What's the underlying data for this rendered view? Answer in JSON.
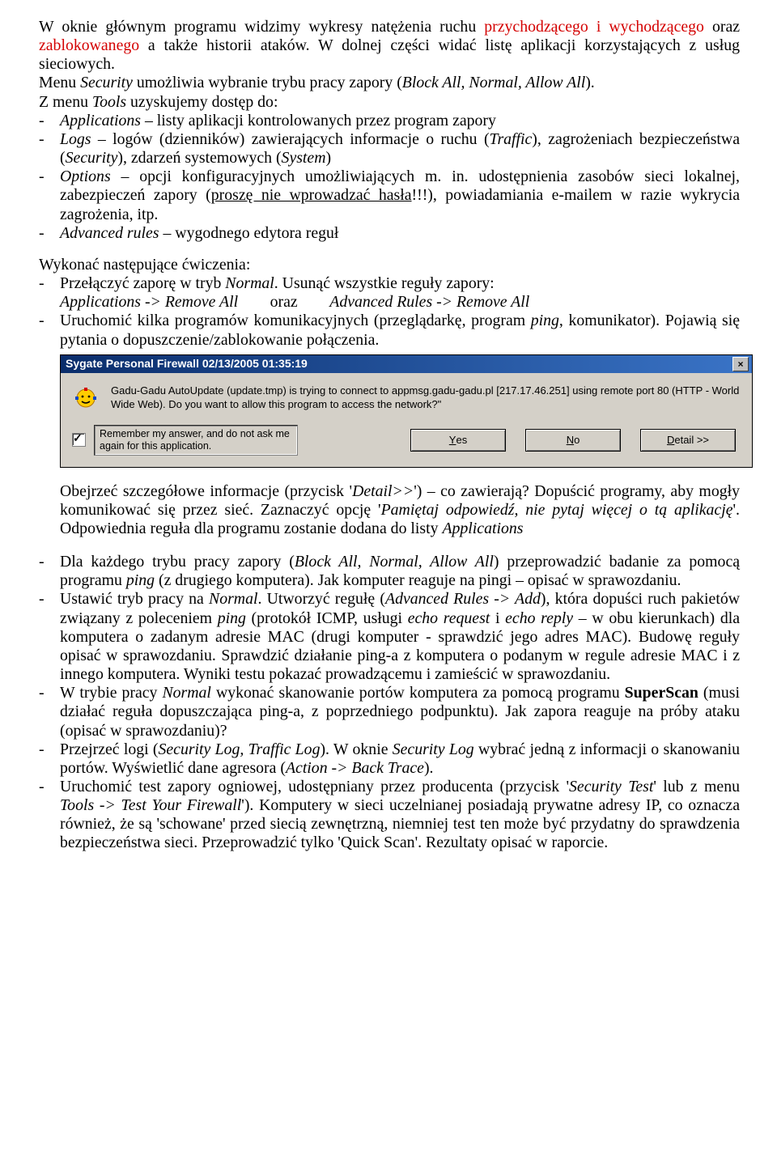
{
  "intro": {
    "pre_red1": "W oknie głównym programu widzimy wykresy natężenia ruchu ",
    "red1": "przychodzącego i wychodzącego",
    "between_red": " oraz ",
    "red2": "zablokowanego",
    "after_red": " a także historii ataków. W dolnej części widać listę aplikacji korzystających z usług sieciowych.",
    "menu_line_a": "Menu ",
    "menu_security": "Security",
    "menu_line_b": " umożliwia wybranie trybu pracy zapory (",
    "menu_modes": "Block All, Normal, Allow All",
    "menu_line_c": ").",
    "tools_a": "Z menu ",
    "tools_word": "Tools",
    "tools_b": " uzyskujemy dostęp do:"
  },
  "tools_items": {
    "dash": "-",
    "app_a": "Applications",
    "app_b": " – listy aplikacji kontrolowanych przez program zapory",
    "logs_a": "Logs",
    "logs_b": " – logów (dzienników) zawierających informacje o ruchu (",
    "logs_traffic": "Traffic",
    "logs_c": "), zagrożeniach bezpieczeństwa (",
    "logs_sec": "Security",
    "logs_d": "), zdarzeń systemowych (",
    "logs_sys": "System",
    "logs_e": ")",
    "opt_a": "Options",
    "opt_b": " – opcji konfiguracyjnych umożliwiających m. in. udostępnienia zasobów sieci lokalnej, zabezpieczeń zapory (",
    "opt_u": "proszę nie wprowadzać hasła",
    "opt_c": "!!!), powiadamiania e-mailem w razie wykrycia zagrożenia, itp.",
    "adv_a": "Advanced rules",
    "adv_b": " – wygodnego edytora reguł"
  },
  "exercise_heading": "Wykonać następujące ćwiczenia:",
  "ex1": {
    "a": "Przełączyć zaporę w tryb ",
    "normal": "Normal",
    "b": ". Usunąć wszystkie reguły zapory:",
    "line2_a": "Applications -> Remove All",
    "line2_mid": "        oraz        ",
    "line2_b": "Advanced Rules -> Remove All"
  },
  "ex2": {
    "a": "Uruchomić kilka programów komunikacyjnych (przeglądarkę, program ",
    "ping": "ping",
    "b": ", komunikator). Pojawią się pytania o dopuszczenie/zablokowanie połączenia."
  },
  "dialog": {
    "title": "Sygate Personal Firewall 02/13/2005 01:35:19",
    "msg": "Gadu-Gadu AutoUpdate (update.tmp) is trying to connect to appmsg.gadu-gadu.pl [217.17.46.251] using remote port 80 (HTTP - World Wide Web). Do you want to allow this program to access the network?\"",
    "remember": "Remember my answer, and do not ask me again for this application.",
    "yes_pre": "",
    "yes_u": "Y",
    "yes_post": "es",
    "no_pre": "",
    "no_u": "N",
    "no_post": "o",
    "detail_pre": "",
    "detail_u": "D",
    "detail_post": "etail >>"
  },
  "after_dialog": {
    "a": "Obejrzeć szczegółowe informacje (przycisk '",
    "detail": "Detail>>",
    "b": "') – co zawierają? Dopuścić programy, aby mogły komunikować się przez sieć. Zaznaczyć opcję '",
    "pam": "Pamiętaj odpowiedź, nie pytaj więcej o tą aplikację",
    "c": "'. Odpowiednia reguła dla programu zostanie dodana do listy ",
    "apps": "Applications"
  },
  "ex3": {
    "a": "Dla każdego trybu pracy zapory (",
    "modes": "Block All, Normal, Allow All",
    "b": ") przeprowadzić badanie za pomocą programu ",
    "ping": "ping",
    "c": " (z drugiego komputera). Jak komputer reaguje na pingi – opisać w sprawozdaniu."
  },
  "ex4": {
    "a": "Ustawić tryb pracy na ",
    "normal": "Normal",
    "b": ". Utworzyć regułę (",
    "adv": "Advanced Rules -> Add",
    "c": "), która dopuści ruch pakietów związany z poleceniem ",
    "ping": "ping",
    "d": " (protokół ICMP, usługi ",
    "ereq": "echo request",
    "e_and": " i ",
    "erep": "echo reply",
    "f": " – w obu kierunkach) dla komputera o zadanym adresie MAC (drugi komputer - sprawdzić jego adres MAC). Budowę reguły opisać w sprawozdaniu. Sprawdzić działanie ping-a z komputera o podanym w regule adresie MAC i z innego komputera. Wyniki testu pokazać prowadzącemu i zamieścić w sprawozdaniu."
  },
  "ex5": {
    "a": "W trybie pracy ",
    "normal": "Normal",
    "b": " wykonać skanowanie portów komputera za pomocą programu ",
    "sscan": "SuperScan",
    "c": " (musi działać reguła dopuszczająca ping-a, z poprzedniego podpunktu). Jak zapora reaguje na próby ataku (opisać w sprawozdaniu)?"
  },
  "ex6": {
    "a": "Przejrzeć logi (",
    "logs": "Security Log, Traffic Log",
    "b": "). W oknie ",
    "seclog": "Security Log",
    "c": " wybrać jedną z informacji o skanowaniu portów. Wyświetlić dane agresora (",
    "back": "Action -> Back Trace",
    "d": ")."
  },
  "ex7": {
    "a": "Uruchomić test zapory ogniowej, udostępniany przez producenta (przycisk '",
    "sect": "Security Test",
    "b": "' lub z menu ",
    "tools": "Tools -> Test Your Firewall",
    "c": "'). Komputery w sieci uczelnianej posiadają prywatne adresy IP, co oznacza również, że są 'schowane' przed siecią zewnętrzną, niemniej test ten może być przydatny do sprawdzenia bezpieczeństwa sieci. Przeprowadzić tylko 'Quick Scan'. Rezultaty opisać w raporcie."
  }
}
